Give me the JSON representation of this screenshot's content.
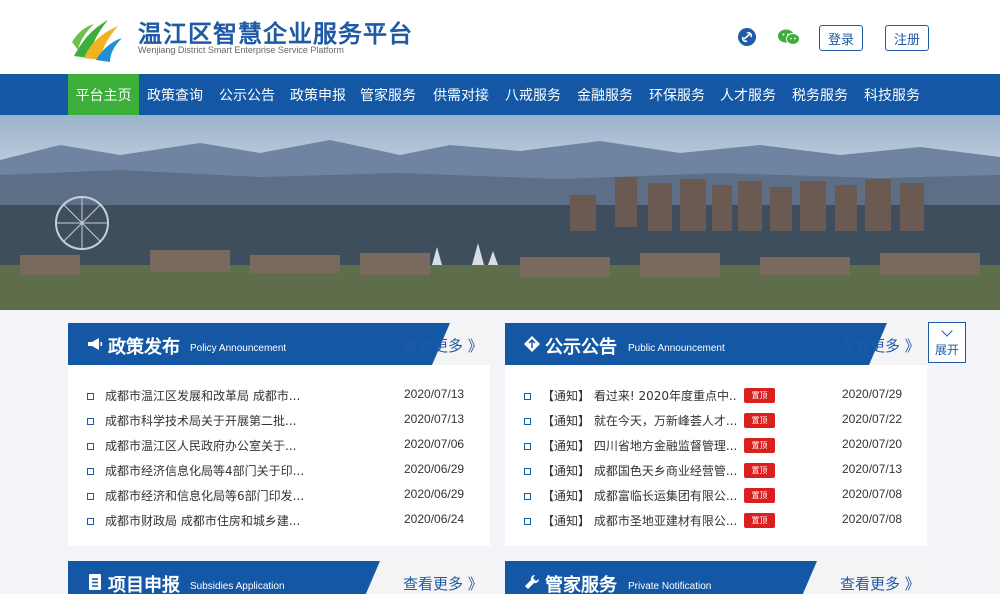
{
  "header": {
    "title": "温江区智慧企业服务平台",
    "subtitle": "Wenjiang District Smart Enterprise Service Platform",
    "icons": [
      "link-icon",
      "wechat-icon"
    ],
    "login_label": "登录",
    "register_label": "注册"
  },
  "nav": {
    "items": [
      "平台主页",
      "政策查询",
      "公示公告",
      "政策申报",
      "管家服务",
      "供需对接",
      "八戒服务",
      "金融服务",
      "环保服务",
      "人才服务",
      "税务服务",
      "科技服务"
    ],
    "active": "平台主页"
  },
  "panels": {
    "policy": {
      "title": "政策发布",
      "title_en": "Policy Announcement",
      "more": "查看更多 》",
      "icon": "megaphone-icon",
      "rows": [
        {
          "title": "成都市温江区发展和改革局 成都市...",
          "date": "2020/07/13"
        },
        {
          "title": "成都市科学技术局关于开展第二批...",
          "date": "2020/07/13"
        },
        {
          "title": "成都市温江区人民政府办公室关于...",
          "date": "2020/07/06"
        },
        {
          "title": "成都市经济信息化局等4部门关于印...",
          "date": "2020/06/29"
        },
        {
          "title": "成都市经济和信息化局等6部门印发...",
          "date": "2020/06/29"
        },
        {
          "title": "成都市财政局 成都市住房和城乡建...",
          "date": "2020/06/24"
        }
      ]
    },
    "public": {
      "title": "公示公告",
      "title_en": "Public Announcement",
      "more": "查看更多 》",
      "icon": "diamond-arrows-icon",
      "rows": [
        {
          "title": "【通知】 看过来! 2020年度重点中...",
          "tag": "置顶",
          "date": "2020/07/29"
        },
        {
          "title": "【通知】 就在今天，万新峰荟人才...",
          "tag": "置顶",
          "date": "2020/07/22"
        },
        {
          "title": "【通知】 四川省地方金融监督管理...",
          "tag": "置顶",
          "date": "2020/07/20"
        },
        {
          "title": "【通知】 成都国色天乡商业经营管...",
          "tag": "置顶",
          "date": "2020/07/13"
        },
        {
          "title": "【通知】 成都富临长运集团有限公...",
          "tag": "置顶",
          "date": "2020/07/08"
        },
        {
          "title": "【通知】 成都市圣地亚建材有限公...",
          "tag": "置顶",
          "date": "2020/07/08"
        }
      ]
    },
    "project": {
      "title": "项目申报",
      "title_en": "Subsidies Application",
      "more": "查看更多 》",
      "icon": "document-icon"
    },
    "steward": {
      "title": "管家服务",
      "title_en": "Private Notification",
      "more": "查看更多 》",
      "icon": "wrench-icon"
    }
  },
  "expand": {
    "label": "展开"
  },
  "colors": {
    "brand_blue": "#1457a5",
    "active_green": "#3cae3a",
    "tag_red": "#d9201e"
  }
}
